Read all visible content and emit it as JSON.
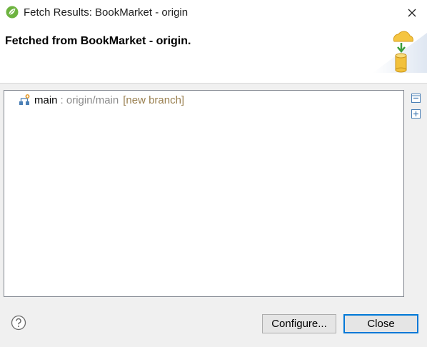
{
  "window": {
    "title": "Fetch Results: BookMarket - origin",
    "app_icon": "eclipse-spring-icon",
    "close_icon": "close-icon"
  },
  "header": {
    "title": "Fetched from BookMarket - origin.",
    "graphic_icon": "cloud-to-database-icon"
  },
  "results": {
    "rows": [
      {
        "icon": "branch-icon",
        "name": "main",
        "remote": ": origin/main",
        "tag": "[new branch]"
      }
    ],
    "collapse_icon": "collapse-all-icon",
    "expand_icon": "expand-all-icon"
  },
  "footer": {
    "help_icon": "help-icon",
    "configure_label": "Configure...",
    "close_label": "Close"
  },
  "colors": {
    "accent": "#0078d7",
    "remote_text": "#8a8a8a",
    "tag_text": "#9a8050",
    "app_icon_green": "#6db33f"
  }
}
